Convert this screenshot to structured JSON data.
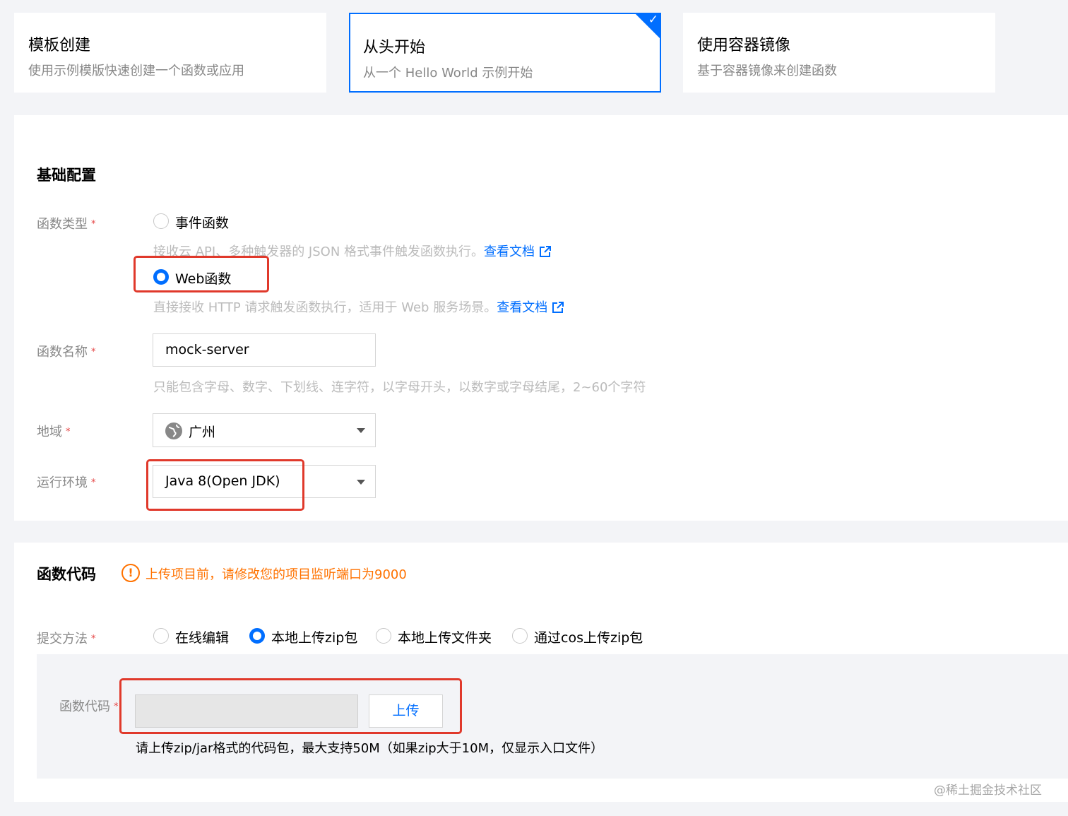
{
  "cards": [
    {
      "title": "模板创建",
      "desc": "使用示例模版快速创建一个函数或应用"
    },
    {
      "title": "从头开始",
      "desc": "从一个 Hello World 示例开始"
    },
    {
      "title": "使用容器镜像",
      "desc": "基于容器镜像来创建函数"
    }
  ],
  "basic": {
    "title": "基础配置",
    "function_type_label": "函数类型",
    "event_option": "事件函数",
    "event_help": "接收云 API、多种触发器的 JSON 格式事件触发函数执行。",
    "web_option": "Web函数",
    "web_help": "直接接收 HTTP 请求触发函数执行，适用于 Web 服务场景。",
    "doc_link": "查看文档",
    "selected_type": "Web函数",
    "name_label": "函数名称",
    "name_value": "mock-server",
    "name_help": "只能包含字母、数字、下划线、连字符，以字母开头，以数字或字母结尾，2~60个字符",
    "region_label": "地域",
    "region_value": "广州",
    "runtime_label": "运行环境",
    "runtime_value": "Java 8(Open JDK)",
    "required_mark": "*"
  },
  "code": {
    "title": "函数代码",
    "warning": "上传项目前，请修改您的项目监听端口为9000",
    "submit_label": "提交方法",
    "methods": [
      "在线编辑",
      "本地上传zip包",
      "本地上传文件夹",
      "通过cos上传zip包"
    ],
    "selected_method": "本地上传zip包",
    "code_label": "函数代码",
    "file_value": "",
    "upload_button": "上传",
    "upload_help": "请上传zip/jar格式的代码包，最大支持50M（如果zip大于10M，仅显示入口文件）"
  },
  "watermark": "@稀土掘金技术社区",
  "colors": {
    "accent": "#006eff",
    "required": "#e54545",
    "warning": "#ff7200",
    "annotation": "#e0392b"
  }
}
